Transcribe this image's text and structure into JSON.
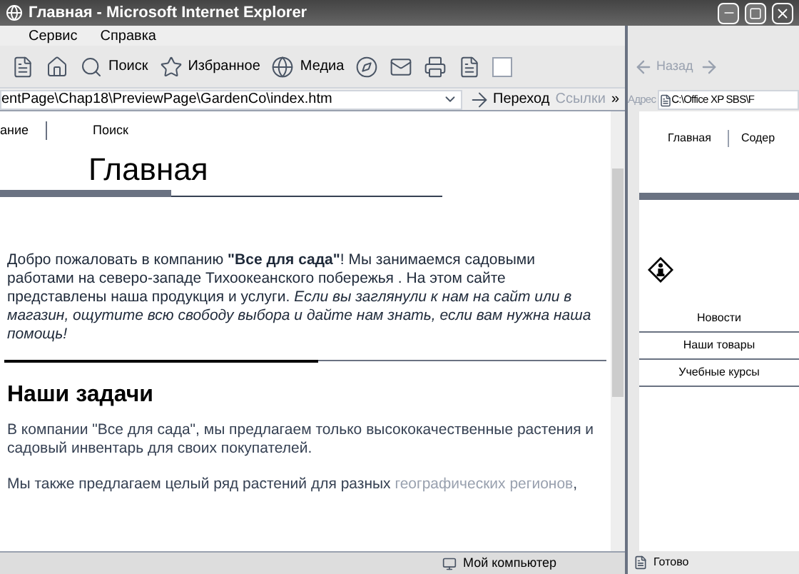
{
  "window": {
    "title": "Главная - Microsoft Internet Explorer"
  },
  "menu": [
    "Сервис",
    "Справка"
  ],
  "toolbar": {
    "search": "Поиск",
    "favorites": "Избранное",
    "media": "Медиа"
  },
  "address": {
    "value": "entPage\\Chap18\\PreviewPage\\GardenCo\\index.htm",
    "go": "Переход",
    "links": "Ссылки",
    "more": "»"
  },
  "page": {
    "nav": [
      "ание",
      "Поиск"
    ],
    "title": "Главная",
    "intro": "Добро пожаловать в компанию **\"Все для сада\"**! Мы занимаемся садовыми работами на северо-западе Тихоокеанского побережья . На этом сайте представлены наша продукция и услуги. *Если вы заглянули к нам на сайт или в магазин, ощутите всю свободу выбора и дайте нам знать, если вам нужна наша помощь!*",
    "section_title": "Наши задачи",
    "paragraphs": [
      {
        "text": "В компании \"Все для сада\", мы предлагаем только высококачественные растения и садовый инвентарь для своих покупателей."
      },
      {
        "text": "Мы также предлагаем целый ряд растений для разных",
        "link": "географических регионов",
        "after": ","
      }
    ]
  },
  "status_bar": {
    "zone": "Мой компьютер"
  },
  "second_window": {
    "back": "Назад",
    "address_label": "Адрес",
    "address": "C:\\Office XP SBS\\F",
    "nav": [
      "Главная",
      "Содер"
    ],
    "links": [
      "Новости",
      "Наши товары",
      "Учебные курсы"
    ],
    "status": "Готово"
  }
}
